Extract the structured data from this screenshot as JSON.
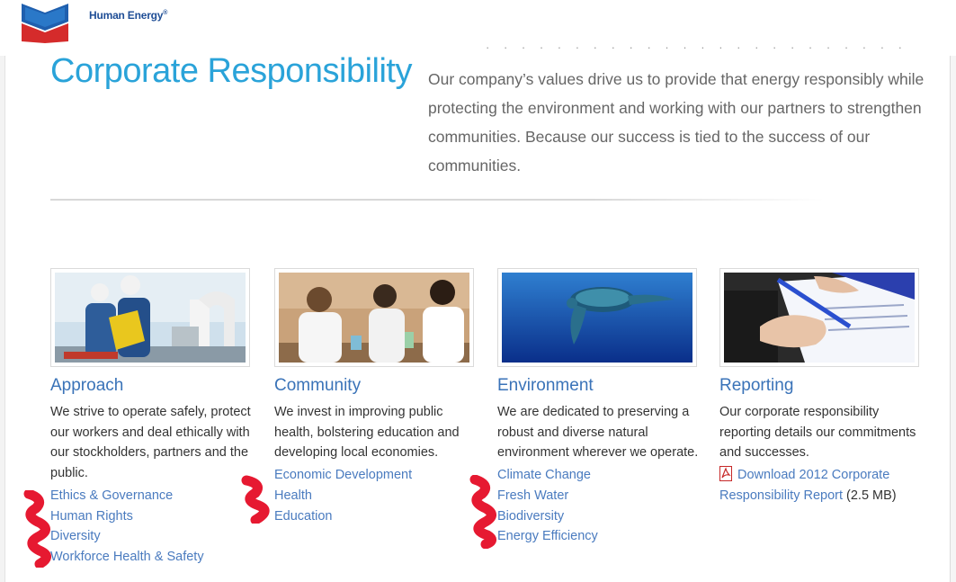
{
  "header": {
    "brand_tagline": "Human Energy",
    "brand_mark": "®"
  },
  "page": {
    "title": "Corporate Responsibility",
    "intro": "Our company’s values drive us to provide that energy responsibly while protecting the environment and working with our partners to strengthen communities. Because our success is tied to the success of our communities."
  },
  "sections": [
    {
      "title": "Approach",
      "description": "We strive to operate safely, protect our workers and deal ethically with our stockholders, partners and the public.",
      "links": [
        "Ethics & Governance",
        "Human Rights",
        "Diversity",
        "Workforce Health & Safety"
      ],
      "image": "workers-with-hard-hats-photo"
    },
    {
      "title": "Community",
      "description": "We invest in improving public health, bolstering education and developing local economies.",
      "links": [
        "Economic Development",
        "Health",
        "Education"
      ],
      "image": "students-in-classroom-photo"
    },
    {
      "title": "Environment",
      "description": "We are dedicated to preserving a robust and diverse natural environment wherever we operate.",
      "links": [
        "Climate Change",
        "Fresh Water",
        "Biodiversity",
        "Energy Efficiency"
      ],
      "image": "sea-turtle-photo"
    },
    {
      "title": "Reporting",
      "description": "Our corporate responsibility reporting details our commitments and successes.",
      "report_link": "Download 2012 Corporate Responsibility Report",
      "report_size": " (2.5 MB)",
      "image": "signing-document-photo"
    }
  ],
  "colors": {
    "title_blue": "#2aa3d9",
    "link_blue": "#4a7bbf",
    "heading_blue": "#3a73b8",
    "logo_blue": "#1f4e96",
    "logo_red": "#d52b2b",
    "annotation_red": "#e3001b"
  },
  "icons": [
    "chevron-logo",
    "pdf-icon"
  ]
}
